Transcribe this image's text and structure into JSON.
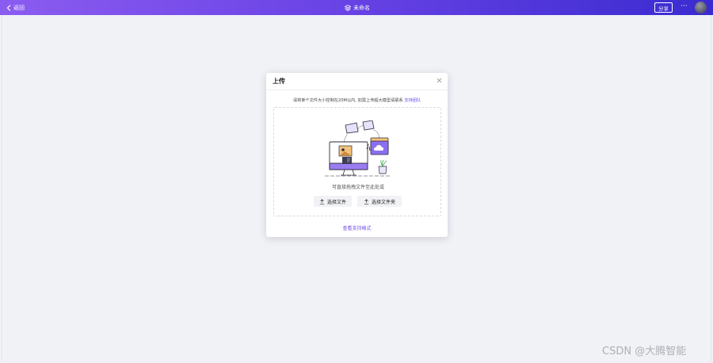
{
  "topbar": {
    "back_label": "返回",
    "doc_title": "未命名",
    "share_label": "分享",
    "more_label": "···",
    "gradient_start": "#8b5cf0",
    "gradient_end": "#3a2bd0"
  },
  "modal": {
    "title": "上传",
    "notice_text": "请将单个文件大小控制在20M以内, 如需上传超大模型请联系",
    "notice_link": "支持团队",
    "drop_hint": "可直接拖拽文件至此处或",
    "select_file_label": "选择文件",
    "select_folder_label": "选择文件夹",
    "formats_link": "查看支持格式",
    "accent_color": "#6d4ae8"
  },
  "watermark": "CSDN @大腾智能"
}
